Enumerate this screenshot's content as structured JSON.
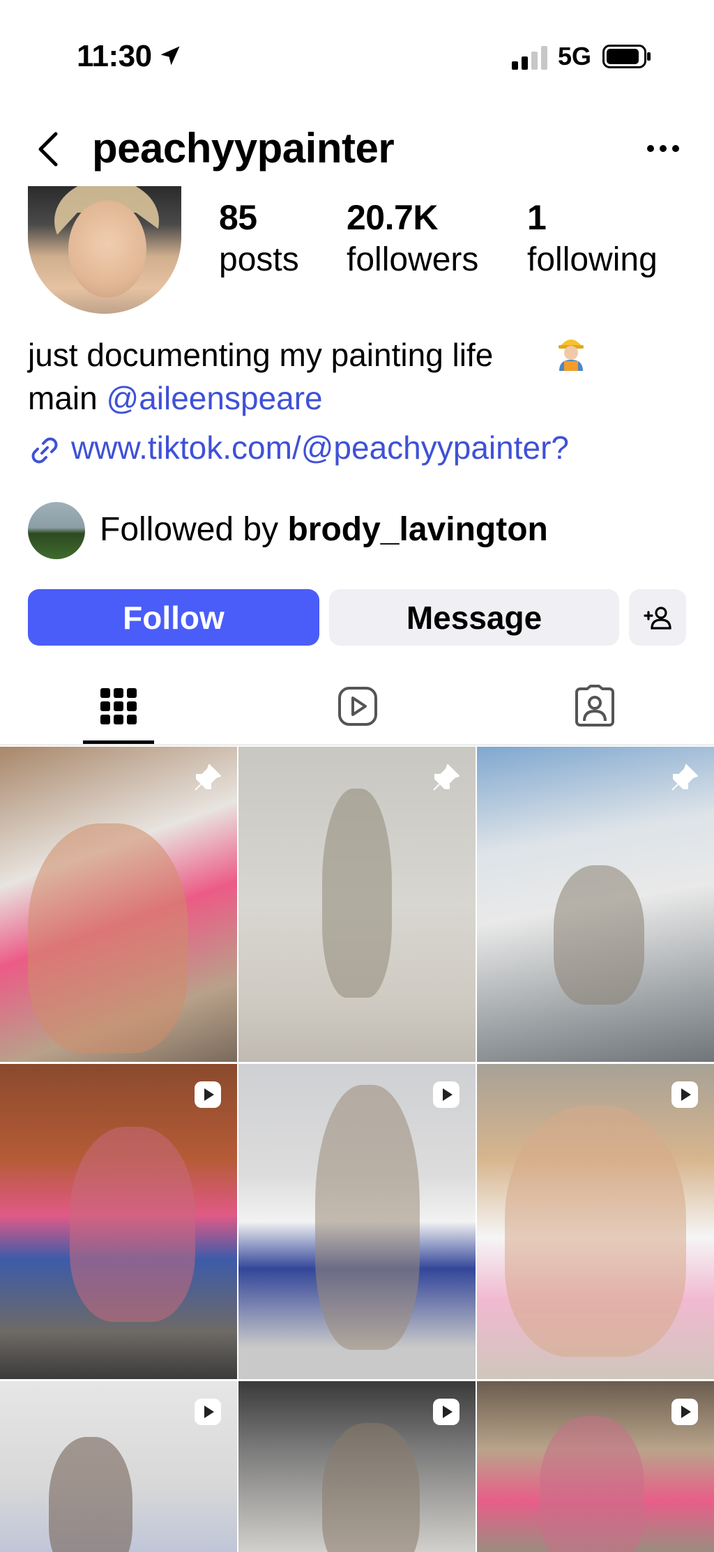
{
  "status_bar": {
    "time": "11:30",
    "network": "5G",
    "location_icon": "location-arrow-icon",
    "signal_icon": "signal-bars-icon",
    "battery_icon": "battery-icon"
  },
  "header": {
    "username": "peachyypainter",
    "back_icon": "chevron-left-icon",
    "more_icon": "ellipsis-icon"
  },
  "stats": {
    "posts": {
      "value": "85",
      "label": "posts"
    },
    "followers": {
      "value": "20.7K",
      "label": "followers"
    },
    "following": {
      "value": "1",
      "label": "following"
    }
  },
  "bio": {
    "line1": "just documenting my painting life",
    "line1_emoji": "construction-worker-emoji",
    "line2_prefix": "main",
    "mention": "@aileenspeare",
    "link": "www.tiktok.com/@peachyypainter?"
  },
  "followed_by": {
    "prefix": "Followed by",
    "user": "brody_lavington"
  },
  "buttons": {
    "follow": "Follow",
    "message": "Message",
    "add_user_icon": "add-person-icon"
  },
  "colors": {
    "accent": "#4a5df9",
    "link": "#3f51d6",
    "secondary_button": "#efeff4"
  },
  "tabs": [
    {
      "name": "posts-grid",
      "icon": "grid-icon",
      "active": true
    },
    {
      "name": "reels",
      "icon": "reels-icon",
      "active": false
    },
    {
      "name": "tagged",
      "icon": "tagged-person-icon",
      "active": false
    }
  ],
  "grid": [
    {
      "badge": "pin-icon"
    },
    {
      "badge": "pin-icon"
    },
    {
      "badge": "pin-icon"
    },
    {
      "badge": "reel-play-icon"
    },
    {
      "badge": "reel-play-icon"
    },
    {
      "badge": "reel-play-icon"
    },
    {
      "badge": "reel-play-icon"
    },
    {
      "badge": "reel-play-icon"
    },
    {
      "badge": "reel-play-icon"
    }
  ]
}
